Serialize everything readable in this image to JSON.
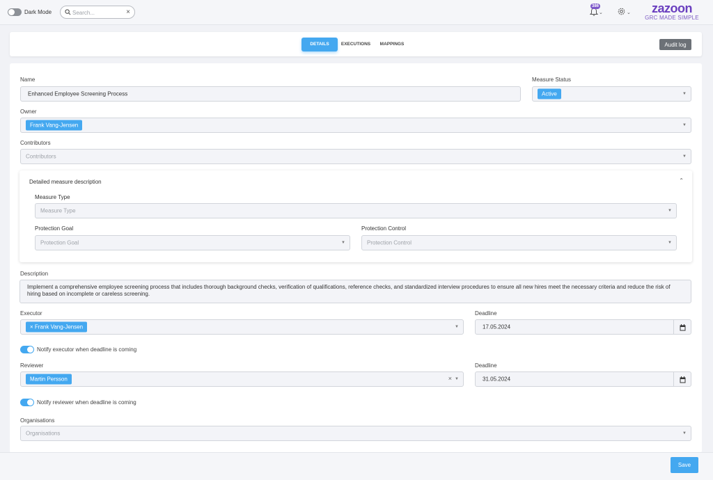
{
  "topbar": {
    "dark_mode_label": "Dark Mode",
    "search_placeholder": "Search...",
    "notifications_count": "386",
    "logo_name": "zazoon",
    "logo_tagline": "GRC MADE SIMPLE",
    "brand_color": "#6a3fbf"
  },
  "tabs": [
    {
      "label": "DETAILS",
      "active": true
    },
    {
      "label": "EXECUTIONS",
      "active": false
    },
    {
      "label": "MAPPINGS",
      "active": false
    }
  ],
  "audit_log_label": "Audit log",
  "form": {
    "name_label": "Name",
    "name_value": "Enhanced Employee Screening Process",
    "measure_status_label": "Measure Status",
    "measure_status_value": "Active",
    "owner_label": "Owner",
    "owner_value": "Frank Vang-Jensen",
    "contributors_label": "Contributors",
    "contributors_placeholder": "Contributors",
    "detailed": {
      "title": "Detailed measure description",
      "measure_type_label": "Measure Type",
      "measure_type_placeholder": "Measure Type",
      "protection_goal_label": "Protection Goal",
      "protection_goal_placeholder": "Protection Goal",
      "protection_control_label": "Protection Control",
      "protection_control_placeholder": "Protection Control"
    },
    "description_label": "Description",
    "description_value": "Implement a comprehensive employee screening process that includes thorough background checks, verification of qualifications, reference checks, and standardized interview procedures to ensure all new hires meet the necessary criteria and reduce the risk of hiring based on incomplete or careless screening.",
    "executor_label": "Executor",
    "executor_value": "Frank Vang-Jensen",
    "executor_deadline_label": "Deadline",
    "executor_deadline_value": "17.05.2024",
    "notify_executor_label": "Notify executor when deadline is coming",
    "reviewer_label": "Reviewer",
    "reviewer_value": "Martin Persson",
    "reviewer_deadline_label": "Deadline",
    "reviewer_deadline_value": "31.05.2024",
    "notify_reviewer_label": "Notify reviewer when deadline is coming",
    "organisations_label": "Organisations",
    "organisations_placeholder": "Organisations"
  },
  "save_label": "Save",
  "accent_color": "#44a8f0"
}
